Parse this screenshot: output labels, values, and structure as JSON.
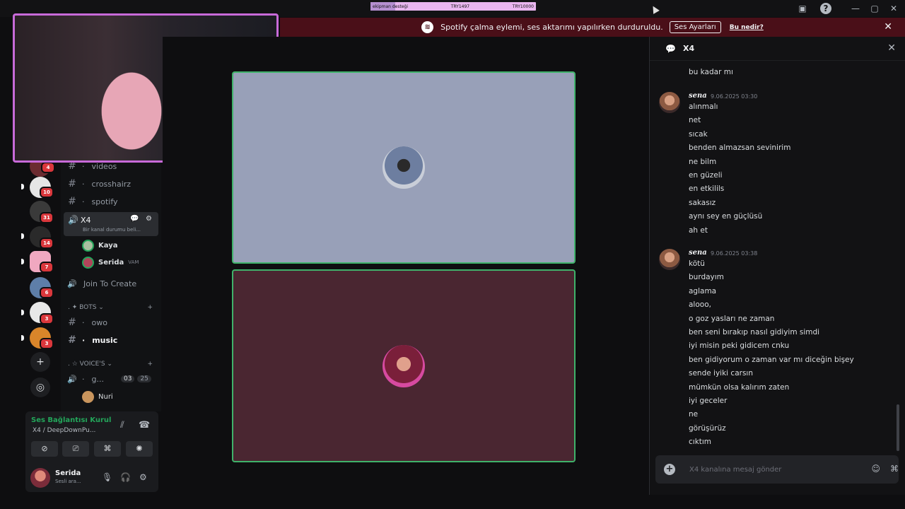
{
  "titlebar": {
    "donation": {
      "left": "ekipman desteği",
      "current": "TRY1497",
      "goal": "TRY10000",
      "progress": 0.15
    },
    "icons": [
      "inbox-icon",
      "help-icon",
      "minimize-icon",
      "maximize-icon",
      "close-icon"
    ],
    "glyphs": {
      "inbox": "▣",
      "help": "?",
      "minimize": "—",
      "maximize": "▢",
      "close": "✕"
    }
  },
  "notice": {
    "text": "Spotify çalma eylemi, ses aktarımı yapılırken durduruldu.",
    "button": "Ses Ayarları",
    "link": "Bu nedir?",
    "close": "✕",
    "spotify_glyph": "≋"
  },
  "rail": {
    "badges": [
      "4",
      "10",
      "31",
      "14",
      "7",
      "6",
      "3",
      "3"
    ],
    "add_glyph": "+",
    "discover_glyph": "◎"
  },
  "channels": {
    "text_channels": [
      {
        "name": "videos"
      },
      {
        "name": "crosshairz"
      },
      {
        "name": "spotify"
      }
    ],
    "voice_channel": {
      "name": "X4",
      "status": "Bir kanal durumu beli...",
      "icons": "💬 ⚙"
    },
    "voice_users": [
      {
        "name": "Kaya",
        "tag": ""
      },
      {
        "name": "Serida",
        "tag": "VAM"
      }
    ],
    "join_to_create": "Join To Create",
    "bots_section": ". ✦ BOTS ⌄",
    "bot_channels": [
      {
        "name": "owo"
      },
      {
        "name": "music"
      }
    ],
    "voices_section": ". ☆ VOICE'S ⌄",
    "voices_channel": {
      "name": "g...",
      "count_a": "03",
      "count_b": "25"
    },
    "voices_user": "Nuri",
    "hash": "#",
    "dot": "·",
    "plus": "+"
  },
  "voice_panel": {
    "state": "Ses Bağlantısı Kurul",
    "channel": "X4 /   DeepDownPu...",
    "buttons": [
      "camera-off",
      "screen-share",
      "activities",
      "soundboard"
    ],
    "glyphs": {
      "camera": "⊘",
      "share": "⎚",
      "games": "⌘",
      "board": "✺",
      "noise": "⫽",
      "disconnect": "☎"
    }
  },
  "user_panel": {
    "name": "Serida",
    "status": "Sesli ara...",
    "glyphs": {
      "mic": "🎙",
      "headset": "🎧",
      "settings": "⚙"
    }
  },
  "stage": {
    "tile_colors": [
      "#98a0b8",
      "#4a2631"
    ],
    "border_color": "#3fb26a"
  },
  "chat": {
    "title": "X4",
    "header_glyph": "💬",
    "close_glyph": "✕",
    "top_lines": [
      "bu kadar mı"
    ],
    "messages": [
      {
        "author": "sena",
        "time": "9.06.2025 03:30",
        "lines": [
          "alınmalı",
          "net",
          "sıcak",
          "benden almazsan sevinirim",
          "ne bilm",
          "en güzeli",
          "en etkilils",
          "sakasız",
          "aynı sey en güçlüsü",
          "ah et"
        ]
      },
      {
        "author": "sena",
        "time": "9.06.2025 03:38",
        "lines": [
          "kötü",
          "burdayım",
          "aglama",
          "alooo,",
          "o goz yasları ne  zaman",
          "ben seni bırakıp nasıl gidiyim simdi",
          "iyi misin peki gidicem cnku",
          "ben gidiyorum o zaman var mı diceğin bişey",
          "sende iyiki carsın",
          "mümkün olsa kalırım zaten",
          "iyi geceler",
          "ne",
          "görüşürüz",
          "cıktım"
        ]
      }
    ],
    "composer_placeholder": "X4 kanalına mesaj gönder",
    "composer_plus": "+",
    "composer_glyphs": {
      "emoji": "☺",
      "game": "⌘"
    }
  }
}
